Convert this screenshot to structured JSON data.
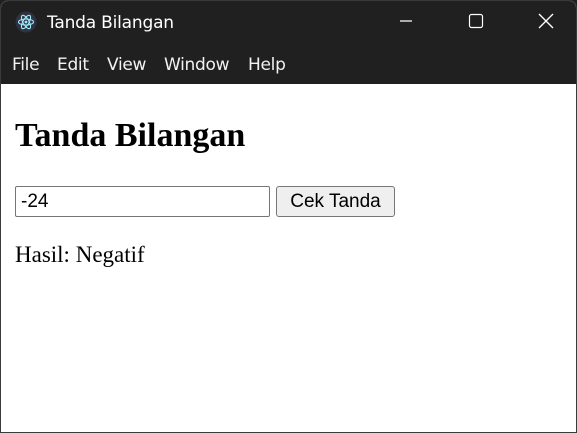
{
  "window": {
    "title": "Tanda Bilangan",
    "icon": "electron-icon",
    "controls": {
      "minimize_icon": "minimize-icon",
      "maximize_icon": "maximize-icon",
      "close_icon": "close-icon"
    }
  },
  "menu": {
    "items": [
      {
        "label": "File"
      },
      {
        "label": "Edit"
      },
      {
        "label": "View"
      },
      {
        "label": "Window"
      },
      {
        "label": "Help"
      }
    ]
  },
  "page": {
    "heading": "Tanda Bilangan",
    "input_value": "-24",
    "button_label": "Cek Tanda",
    "result_label": "Hasil:",
    "result_value": "Negatif"
  },
  "colors": {
    "titlebar": "#202020",
    "content_bg": "#ffffff",
    "button_bg": "#efefef",
    "border": "#767676"
  }
}
